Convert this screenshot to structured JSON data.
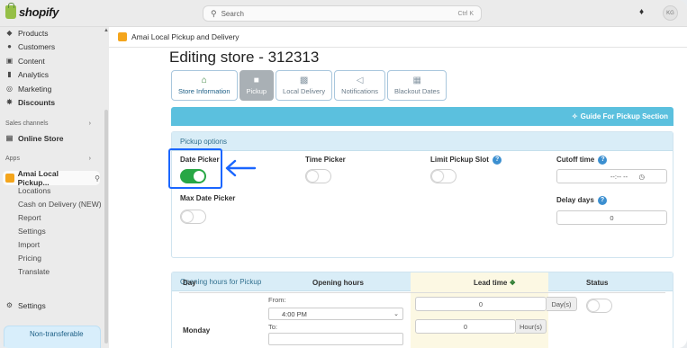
{
  "topbar": {
    "logo_text": "shopify",
    "search_placeholder": "Search",
    "search_shortcut": "Ctrl K",
    "avatar_initials": "KG"
  },
  "sidebar": {
    "items": [
      {
        "label": "Products",
        "icon": "tag-icon"
      },
      {
        "label": "Customers",
        "icon": "person-icon"
      },
      {
        "label": "Content",
        "icon": "content-icon"
      },
      {
        "label": "Analytics",
        "icon": "bar-chart-icon"
      },
      {
        "label": "Marketing",
        "icon": "target-icon"
      },
      {
        "label": "Discounts",
        "icon": "discount-icon"
      }
    ],
    "sales_channels_label": "Sales channels",
    "online_store_label": "Online Store",
    "apps_label": "Apps",
    "app_name": "Amai Local Pickup...",
    "app_subitems": [
      "Locations",
      "Cash on Delivery (NEW)",
      "Report",
      "Settings",
      "Import",
      "Pricing",
      "Translate"
    ],
    "settings_label": "Settings",
    "bottom_card_text": "Non-transferable"
  },
  "main": {
    "breadcrumb": "Amai Local Pickup and Delivery",
    "title": "Editing store - 312313",
    "tabs": [
      {
        "label": "Store Information",
        "icon": "home-icon"
      },
      {
        "label": "Pickup",
        "icon": "bag-icon"
      },
      {
        "label": "Local Delivery",
        "icon": "truck-icon"
      },
      {
        "label": "Notifications",
        "icon": "megaphone-icon"
      },
      {
        "label": "Blackout Dates",
        "icon": "calendar-icon"
      }
    ],
    "guide_label": "Guide For Pickup Section",
    "pickup_options": {
      "header": "Pickup options",
      "date_picker_label": "Date Picker",
      "date_picker_on": true,
      "time_picker_label": "Time Picker",
      "time_picker_on": false,
      "limit_slot_label": "Limit Pickup Slot",
      "limit_slot_on": false,
      "cutoff_label": "Cutoff time",
      "cutoff_value": "--:-- --",
      "max_date_label": "Max Date Picker",
      "max_date_on": false,
      "delay_label": "Delay days",
      "delay_value": "0"
    },
    "opening_hours": {
      "header": "Opening hours for Pickup",
      "col_day": "Day",
      "col_hours": "Opening hours",
      "col_lead": "Lead time",
      "col_status": "Status",
      "row_day": "Monday",
      "from_label": "From:",
      "from_value": "4:00 PM",
      "to_label": "To:",
      "lead_days_value": "0",
      "lead_days_unit": "Day(s)",
      "lead_hours_value": "0",
      "lead_hours_unit": "Hour(s)",
      "status_on": false
    }
  },
  "colors": {
    "accent_blue": "#1a66ff",
    "guide_bar": "#5bc0de",
    "toggle_on": "#28a745",
    "panel_head": "#d9edf7"
  }
}
